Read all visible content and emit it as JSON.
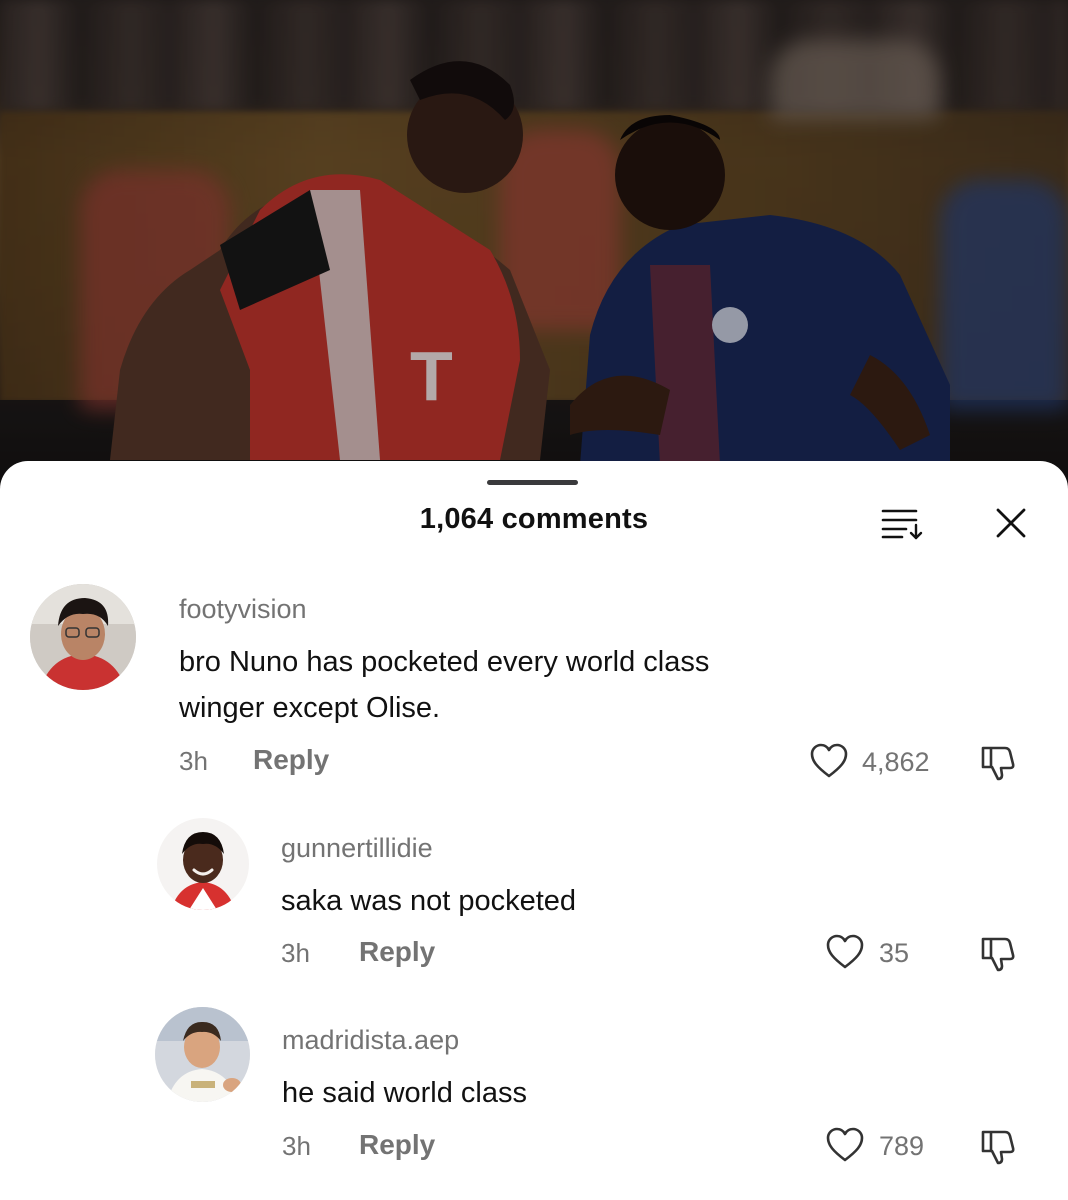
{
  "header": {
    "title": "1,064 comments",
    "sort_icon": "sort-icon",
    "close_icon": "close-icon"
  },
  "comments": [
    {
      "username": "footyvision",
      "text_line1": "bro Nuno has pocketed every world class",
      "text_line2": "winger except Olise.",
      "time": "3h",
      "reply_label": "Reply",
      "likes": "4,862"
    },
    {
      "username": "gunnertillidie",
      "text_line1": "saka was not pocketed",
      "time": "3h",
      "reply_label": "Reply",
      "likes": "35"
    },
    {
      "username": "madridista.aep",
      "text_line1": "he said world class",
      "time": "3h",
      "reply_label": "Reply",
      "likes": "789"
    }
  ],
  "colors": {
    "sheet_bg": "#ffffff",
    "title_text": "#111111",
    "secondary_text": "#737373",
    "home_kit_red": "#d7312f",
    "away_kit_navy": "#1b2a5c"
  }
}
